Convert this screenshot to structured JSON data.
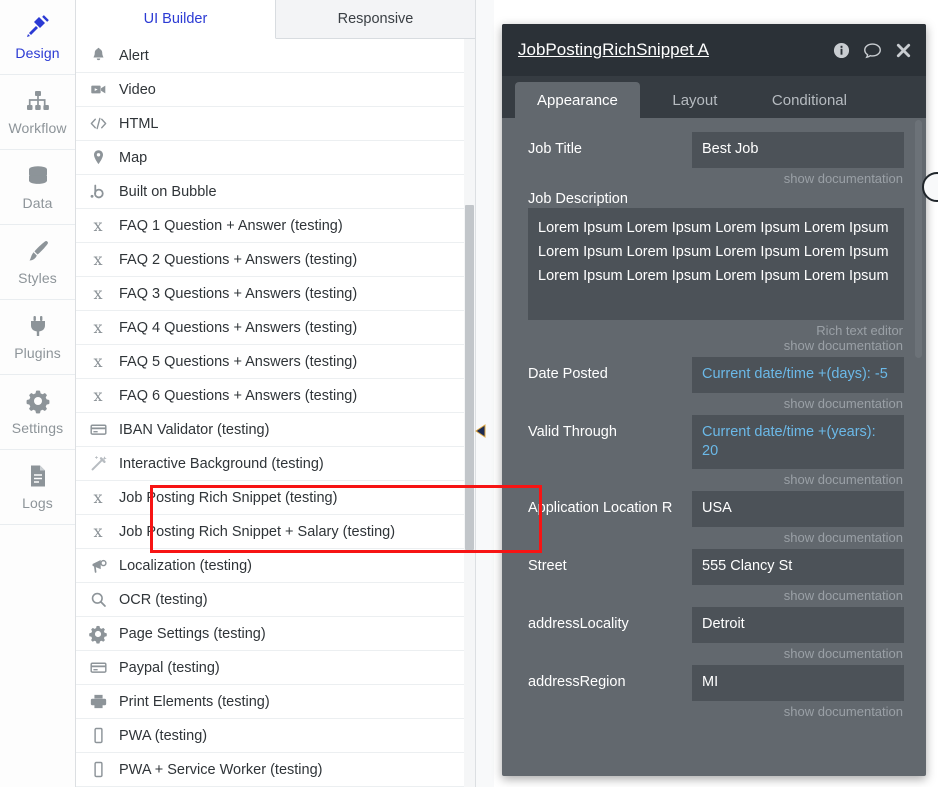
{
  "rail": {
    "items": [
      {
        "label": "Design",
        "icon": "design-tools-icon",
        "active": true
      },
      {
        "label": "Workflow",
        "icon": "workflow-nodes-icon",
        "active": false
      },
      {
        "label": "Data",
        "icon": "database-icon",
        "active": false
      },
      {
        "label": "Styles",
        "icon": "paintbrush-icon",
        "active": false
      },
      {
        "label": "Plugins",
        "icon": "plug-icon",
        "active": false
      },
      {
        "label": "Settings",
        "icon": "gear-icon",
        "active": false
      },
      {
        "label": "Logs",
        "icon": "document-icon",
        "active": false
      }
    ]
  },
  "list": {
    "tabs": [
      {
        "label": "UI Builder",
        "active": true
      },
      {
        "label": "Responsive",
        "active": false
      }
    ],
    "rows": [
      {
        "label": "Alert",
        "icon": "bell-icon"
      },
      {
        "label": "Video",
        "icon": "video-camera-icon"
      },
      {
        "label": "HTML",
        "icon": "code-brackets-icon"
      },
      {
        "label": "Map",
        "icon": "map-pin-icon"
      },
      {
        "label": "Built on Bubble",
        "icon": "bubble-logo-icon"
      },
      {
        "label": "FAQ 1 Question + Answer (testing)",
        "icon": "plugin-icon"
      },
      {
        "label": "FAQ 2 Questions + Answers (testing)",
        "icon": "plugin-icon"
      },
      {
        "label": "FAQ 3 Questions + Answers (testing)",
        "icon": "plugin-icon"
      },
      {
        "label": "FAQ 4 Questions + Answers (testing)",
        "icon": "plugin-icon"
      },
      {
        "label": "FAQ 5 Questions + Answers (testing)",
        "icon": "plugin-icon"
      },
      {
        "label": "FAQ 6 Questions + Answers (testing)",
        "icon": "plugin-icon"
      },
      {
        "label": "IBAN Validator (testing)",
        "icon": "credit-card-icon"
      },
      {
        "label": "Interactive Background (testing)",
        "icon": "magic-wand-icon"
      },
      {
        "label": "Job Posting Rich Snippet (testing)",
        "icon": "plugin-icon",
        "highlighted": true
      },
      {
        "label": "Job Posting Rich Snippet + Salary (testing)",
        "icon": "plugin-icon",
        "highlighted": true
      },
      {
        "label": "Localization (testing)",
        "icon": "megaphone-icon"
      },
      {
        "label": "OCR (testing)",
        "icon": "search-icon"
      },
      {
        "label": "Page Settings (testing)",
        "icon": "gear-icon"
      },
      {
        "label": "Paypal (testing)",
        "icon": "credit-card-icon"
      },
      {
        "label": "Print Elements (testing)",
        "icon": "printer-icon"
      },
      {
        "label": "PWA (testing)",
        "icon": "mobile-phone-icon"
      },
      {
        "label": "PWA + Service Worker (testing)",
        "icon": "mobile-phone-icon"
      }
    ]
  },
  "panel": {
    "title": "JobPostingRichSnippet A",
    "header_icons": [
      {
        "name": "info-icon"
      },
      {
        "name": "comment-icon"
      },
      {
        "name": "close-icon"
      }
    ],
    "tabs": [
      {
        "label": "Appearance",
        "active": true
      },
      {
        "label": "Layout",
        "active": false
      },
      {
        "label": "Conditional",
        "active": false
      }
    ],
    "help_label": "show documentation",
    "rich_text_label": "Rich text editor",
    "fields": [
      {
        "label": "Job Title",
        "value": "Best Job",
        "dynamic": false,
        "layout": "inline"
      },
      {
        "label": "Job Description",
        "value": "Lorem Ipsum Lorem Ipsum Lorem Ipsum Lorem Ipsum Lorem Ipsum Lorem Ipsum Lorem Ipsum Lorem Ipsum Lorem Ipsum Lorem Ipsum Lorem Ipsum Lorem Ipsum",
        "dynamic": false,
        "layout": "block",
        "rich_text": true
      },
      {
        "label": "Date Posted",
        "value": "Current date/time +(days): -5",
        "dynamic": true,
        "layout": "inline"
      },
      {
        "label": "Valid Through",
        "value": "Current date/time +(years): 20",
        "dynamic": true,
        "layout": "inline"
      },
      {
        "label": "Application Location R",
        "value": "USA",
        "dynamic": false,
        "layout": "inline"
      },
      {
        "label": "Street",
        "value": "555 Clancy St",
        "dynamic": false,
        "layout": "inline"
      },
      {
        "label": "addressLocality",
        "value": "Detroit",
        "dynamic": false,
        "layout": "inline"
      },
      {
        "label": "addressRegion",
        "value": "MI",
        "dynamic": false,
        "layout": "inline"
      }
    ]
  },
  "colors": {
    "accent_blue": "#2b3ad4",
    "panel_bg": "#62686e",
    "panel_header": "#2b3137",
    "input_bg": "#4c5258",
    "dynamic_text": "#6bb9e8",
    "highlight_red": "#f71414"
  }
}
